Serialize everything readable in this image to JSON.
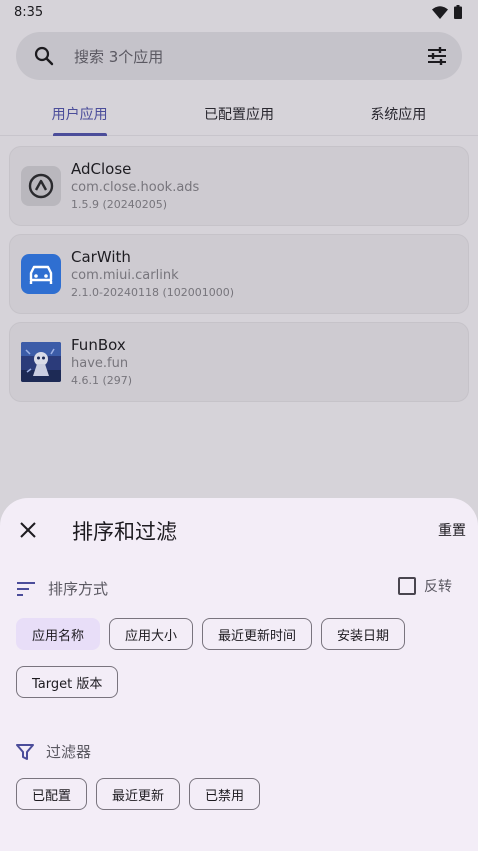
{
  "status": {
    "time": "8:35"
  },
  "search": {
    "placeholder": "搜索 3个应用"
  },
  "tabs": [
    {
      "label": "用户应用",
      "active": true
    },
    {
      "label": "已配置应用",
      "active": false
    },
    {
      "label": "系统应用",
      "active": false
    }
  ],
  "apps": [
    {
      "name": "AdClose",
      "package": "com.close.hook.ads",
      "version": "1.5.9 (20240205)",
      "icon": "adclose-icon"
    },
    {
      "name": "CarWith",
      "package": "com.miui.carlink",
      "version": "2.1.0-20240118 (102001000)",
      "icon": "carwith-icon"
    },
    {
      "name": "FunBox",
      "package": "have.fun",
      "version": "4.6.1 (297)",
      "icon": "funbox-icon"
    }
  ],
  "sheet": {
    "title": "排序和过滤",
    "reset_label": "重置",
    "sort_label": "排序方式",
    "reverse_label": "反转",
    "sort_chips": [
      {
        "label": "应用名称",
        "selected": true
      },
      {
        "label": "应用大小",
        "selected": false
      },
      {
        "label": "最近更新时间",
        "selected": false
      },
      {
        "label": "安装日期",
        "selected": false
      },
      {
        "label": "Target 版本",
        "selected": false
      }
    ],
    "filter_label": "过滤器",
    "filter_chips": [
      {
        "label": "已配置",
        "selected": false
      },
      {
        "label": "最近更新",
        "selected": false
      },
      {
        "label": "已禁用",
        "selected": false
      }
    ]
  },
  "colors": {
    "accent": "#4b4d9a",
    "sheet_bg": "#f3edf7",
    "chip_selected": "#e8def8",
    "scrim": "#d6d3d9"
  }
}
